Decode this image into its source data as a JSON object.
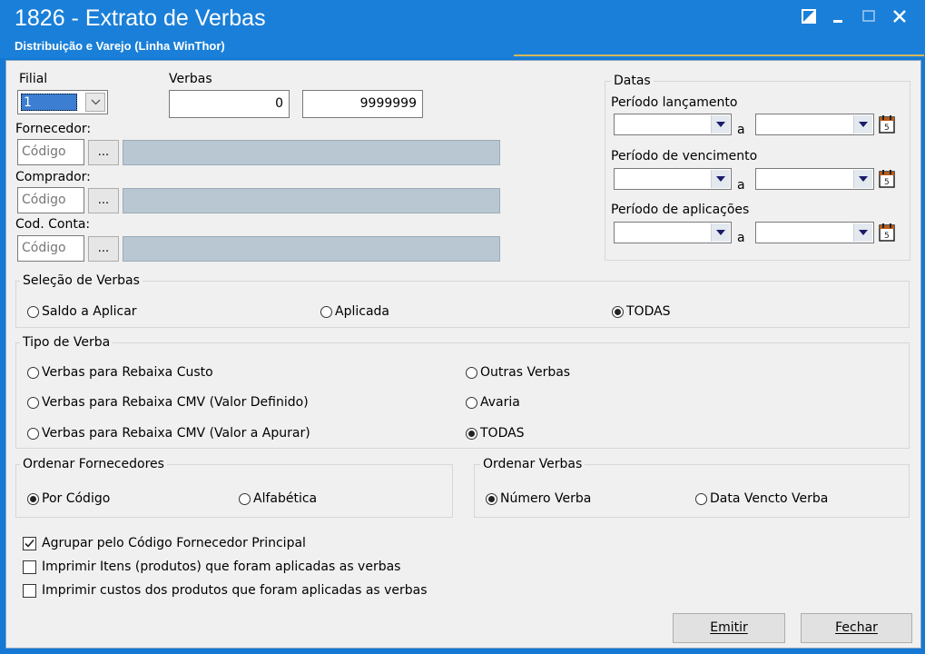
{
  "window": {
    "title": "1826 - Extrato de Verbas",
    "subtitle": "Distribuição e Varejo (Linha WinThor)"
  },
  "filial": {
    "label": "Filial",
    "value": "1"
  },
  "verbas": {
    "label": "Verbas",
    "from": "0",
    "to": "9999999"
  },
  "fornecedor": {
    "label": "Fornecedor:",
    "placeholder": "Código",
    "button": "..."
  },
  "comprador": {
    "label": "Comprador:",
    "placeholder": "Código",
    "button": "..."
  },
  "cod_conta": {
    "label": "Cod. Conta:",
    "placeholder": "Código",
    "button": "..."
  },
  "datas": {
    "title": "Datas",
    "lancamento_label": "Período lançamento",
    "vencimento_label": "Período de vencimento",
    "aplicacoes_label": "Período de aplicações",
    "sep": "a"
  },
  "selecao_verbas": {
    "title": "Seleção de Verbas",
    "options": [
      "Saldo a Aplicar",
      "Aplicada",
      "TODAS"
    ],
    "selected": "TODAS"
  },
  "tipo_verba": {
    "title": "Tipo de Verba",
    "options": [
      "Verbas para Rebaixa Custo",
      "Verbas para Rebaixa CMV (Valor Definido)",
      "Verbas para Rebaixa CMV (Valor a Apurar)",
      "Outras Verbas",
      "Avaria",
      "TODAS"
    ],
    "selected": "TODAS"
  },
  "ordenar_fornecedores": {
    "title": "Ordenar Fornecedores",
    "options": [
      "Por Código",
      "Alfabética"
    ],
    "selected": "Por Código"
  },
  "ordenar_verbas": {
    "title": "Ordenar Verbas",
    "options": [
      "Número Verba",
      "Data Vencto Verba"
    ],
    "selected": "Número Verba"
  },
  "checkboxes": [
    {
      "label": "Agrupar pelo Código Fornecedor Principal",
      "checked": true
    },
    {
      "label": "Imprimir Itens (produtos) que foram aplicadas as verbas",
      "checked": false
    },
    {
      "label": "Imprimir custos dos produtos que foram aplicadas as verbas",
      "checked": false
    }
  ],
  "buttons": {
    "emitir": "Emitir",
    "fechar": "Fechar"
  }
}
